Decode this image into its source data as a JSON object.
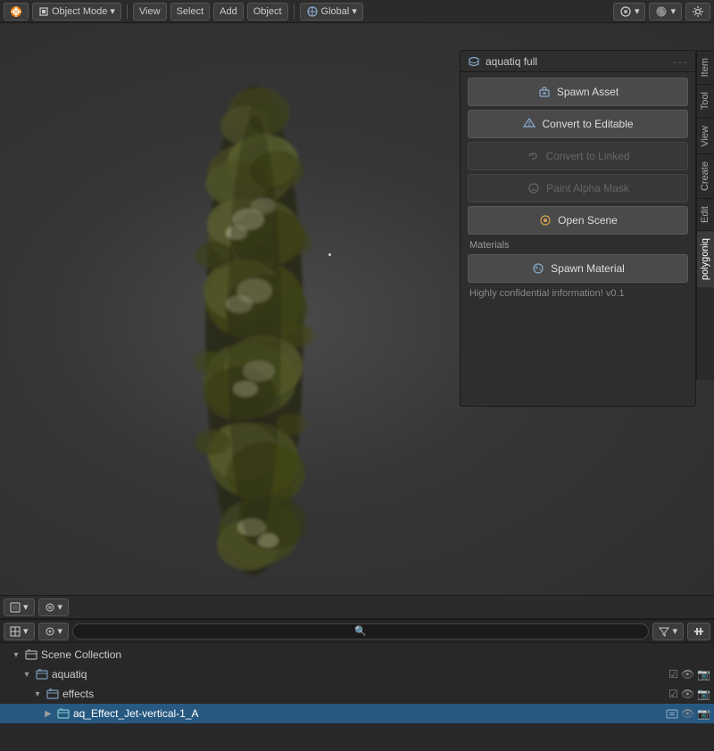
{
  "topToolbar": {
    "mode": "Object Mode",
    "view": "View",
    "select": "Select",
    "add": "Add",
    "object": "Object",
    "transform": "Global",
    "items": [
      "Object Mode",
      "View",
      "Select",
      "Add",
      "Object",
      "Global"
    ]
  },
  "viewport": {
    "backgroundColor": "#3a3a3a"
  },
  "rightPanel": {
    "title": "aquatiq full",
    "headerDots": "···",
    "buttons": [
      {
        "id": "spawn-asset",
        "label": "Spawn Asset",
        "icon": "spawn",
        "disabled": false
      },
      {
        "id": "convert-editable",
        "label": "Convert to Editable",
        "icon": "convert",
        "disabled": false
      },
      {
        "id": "convert-linked",
        "label": "Convert to Linked",
        "icon": "convert",
        "disabled": true
      },
      {
        "id": "paint-alpha",
        "label": "Paint Alpha Mask",
        "icon": "paint",
        "disabled": true
      },
      {
        "id": "open-scene",
        "label": "Open Scene",
        "icon": "scene",
        "disabled": false
      }
    ],
    "sectionMaterials": "Materials",
    "materialButton": {
      "label": "Spawn Material",
      "icon": "material"
    },
    "infoText": "Highly confidential information! v0.1"
  },
  "sideTabs": [
    {
      "id": "item",
      "label": "Item"
    },
    {
      "id": "tool",
      "label": "Tool"
    },
    {
      "id": "view",
      "label": "View"
    },
    {
      "id": "create",
      "label": "Create"
    },
    {
      "id": "edit",
      "label": "Edit"
    },
    {
      "id": "polygoniq",
      "label": "polygoniq",
      "active": true
    }
  ],
  "viewportBottomBar": {
    "viewModes": [
      "view",
      "select",
      "layout"
    ],
    "searchPlaceholder": "🔍"
  },
  "outliner": {
    "searchPlaceholder": "🔍",
    "filterIcon": "🔽",
    "items": [
      {
        "id": "scene-collection",
        "label": "Scene Collection",
        "indent": 0,
        "type": "collection",
        "expanded": true,
        "hasVisibility": false
      },
      {
        "id": "aquatiq",
        "label": "aquatiq",
        "indent": 1,
        "type": "collection",
        "expanded": true,
        "hasVisibility": true,
        "checkVisible": true
      },
      {
        "id": "effects",
        "label": "effects",
        "indent": 2,
        "type": "collection",
        "expanded": true,
        "hasVisibility": true,
        "checkVisible": true
      },
      {
        "id": "aq-effect",
        "label": "aq_Effect_Jet-vertical-1_A",
        "indent": 3,
        "type": "object",
        "expanded": false,
        "hasVisibility": true,
        "checkVisible": true,
        "selected": true
      }
    ]
  }
}
